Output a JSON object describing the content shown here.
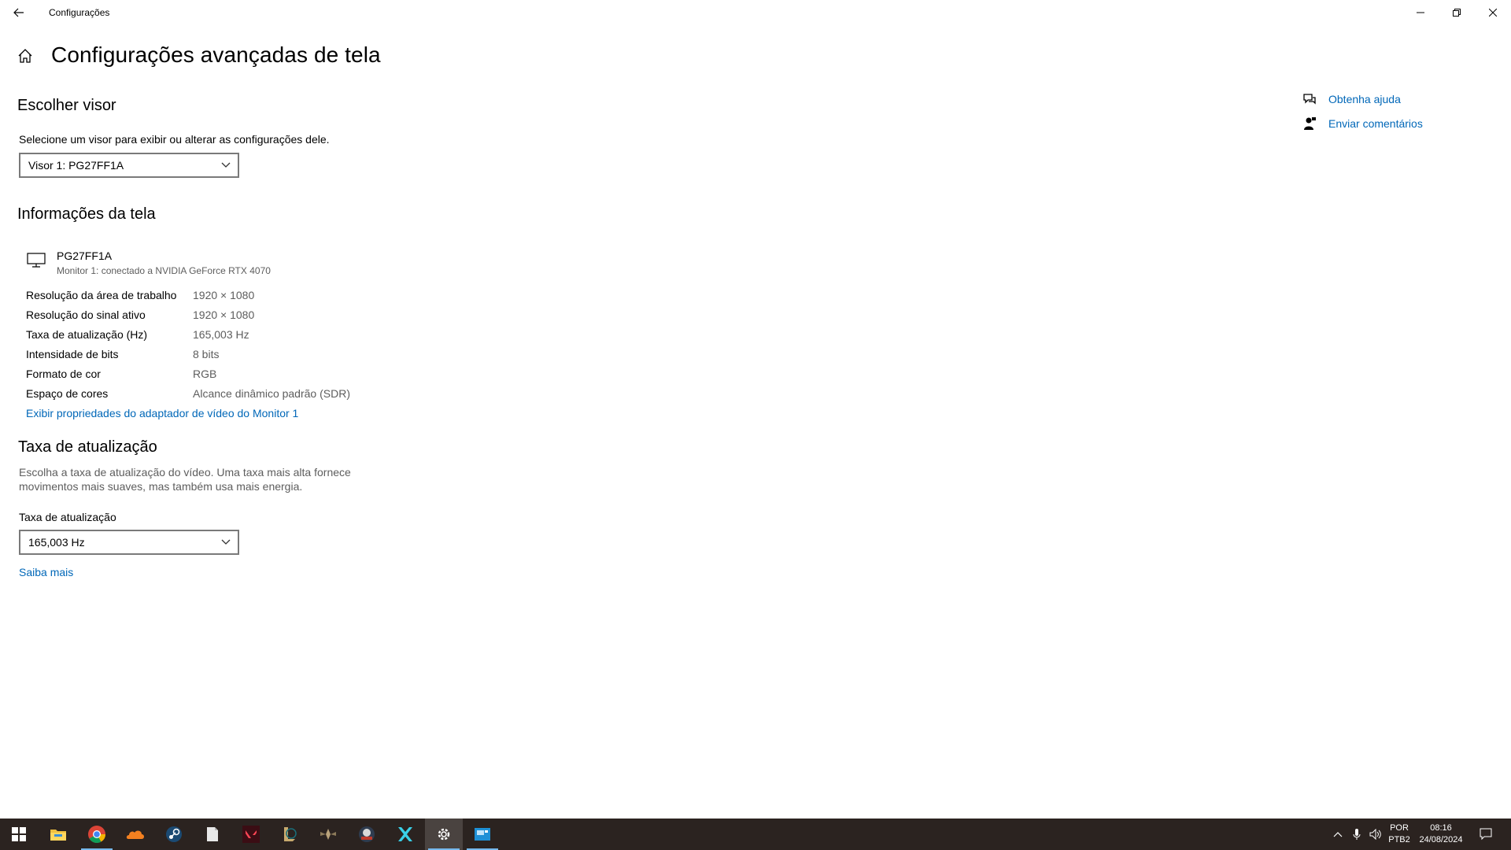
{
  "window": {
    "title": "Configurações"
  },
  "page": {
    "title": "Configurações avançadas de tela"
  },
  "choose_display": {
    "heading": "Escolher visor",
    "instruction": "Selecione um visor para exibir ou alterar as configurações dele.",
    "selected": "Visor 1: PG27FF1A"
  },
  "display_info": {
    "heading": "Informações da tela",
    "monitor_name": "PG27FF1A",
    "monitor_sub": "Monitor 1: conectado a NVIDIA GeForce RTX 4070",
    "rows": [
      {
        "label": "Resolução da área de trabalho",
        "value": "1920 × 1080"
      },
      {
        "label": "Resolução do sinal ativo",
        "value": "1920 × 1080"
      },
      {
        "label": "Taxa de atualização (Hz)",
        "value": "165,003 Hz"
      },
      {
        "label": "Intensidade de bits",
        "value": "8 bits"
      },
      {
        "label": "Formato de cor",
        "value": "RGB"
      },
      {
        "label": "Espaço de cores",
        "value": "Alcance dinâmico padrão (SDR)"
      }
    ],
    "adapter_link": "Exibir propriedades do adaptador de vídeo do Monitor 1"
  },
  "refresh_rate": {
    "heading": "Taxa de atualização",
    "description_line1": "Escolha a taxa de atualização do vídeo. Uma taxa mais alta fornece",
    "description_line2": "movimentos mais suaves, mas também usa mais energia.",
    "field_label": "Taxa de atualização",
    "selected": "165,003 Hz",
    "learn_more": "Saiba mais"
  },
  "help": {
    "get_help": "Obtenha ajuda",
    "feedback": "Enviar comentários"
  },
  "taskbar": {
    "apps": [
      "start-icon",
      "file-explorer-icon",
      "chrome-icon",
      "cloud-app-icon",
      "steam-icon",
      "file-icon",
      "valorant-icon",
      "league-icon",
      "wings-app-icon",
      "game-app-icon",
      "x-app-icon",
      "settings-icon",
      "display-app-icon"
    ],
    "lang_top": "POR",
    "lang_bottom": "PTB2",
    "time": "08:16",
    "date": "24/08/2024"
  },
  "colors": {
    "accent_link": "#0067b8",
    "taskbar_bg": "#2b2320",
    "active_underline": "#76b9ed"
  }
}
